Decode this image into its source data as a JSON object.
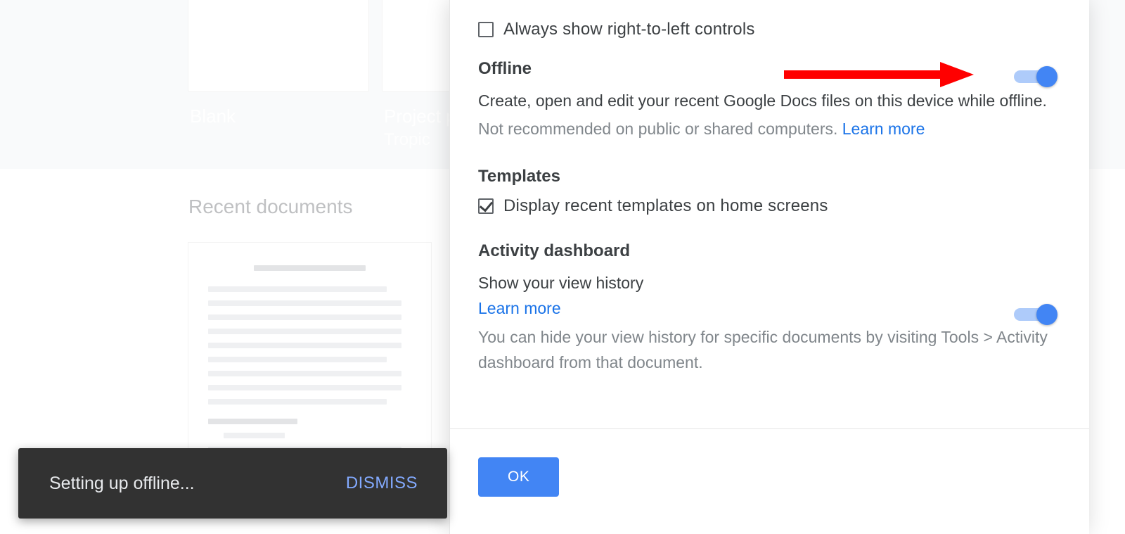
{
  "background": {
    "template1_label": "Blank",
    "template2_label": "Project p",
    "template2_sub": "Tropic",
    "recent_heading": "Recent documents"
  },
  "settings": {
    "rtl_checkbox_label": "Always show right-to-left controls",
    "offline": {
      "heading": "Offline",
      "desc": "Create, open and edit your recent Google Docs files on this device while offline.",
      "warn": "Not recommended on public or shared computers. ",
      "learn_more": "Learn more"
    },
    "templates": {
      "heading": "Templates",
      "checkbox_label": "Display recent templates on home screens"
    },
    "activity": {
      "heading": "Activity dashboard",
      "sub": "Show your view history",
      "learn_more": "Learn more",
      "note": "You can hide your view history for specific documents by visiting Tools > Activity dashboard from that document."
    },
    "ok_label": "OK"
  },
  "toast": {
    "message": "Setting up offline...",
    "action": "DISMISS"
  }
}
